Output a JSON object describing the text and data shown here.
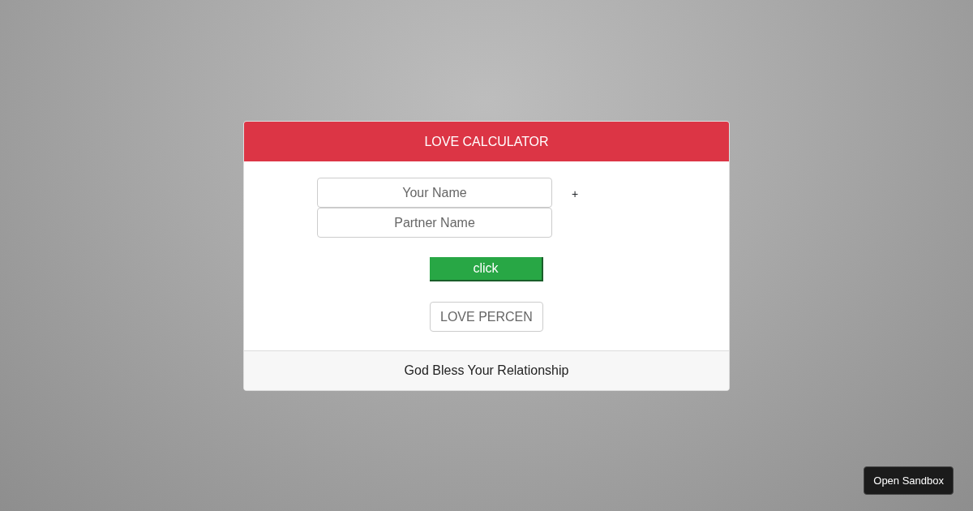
{
  "card": {
    "title": "LOVE CALCULATOR",
    "your_name": {
      "placeholder": "Your Name"
    },
    "plus": "+",
    "partner_name": {
      "placeholder": "Partner Name"
    },
    "button": "click",
    "result": {
      "placeholder": "LOVE PERCEN"
    },
    "footer": "God Bless Your Relationship"
  },
  "sandbox_button": "Open Sandbox"
}
